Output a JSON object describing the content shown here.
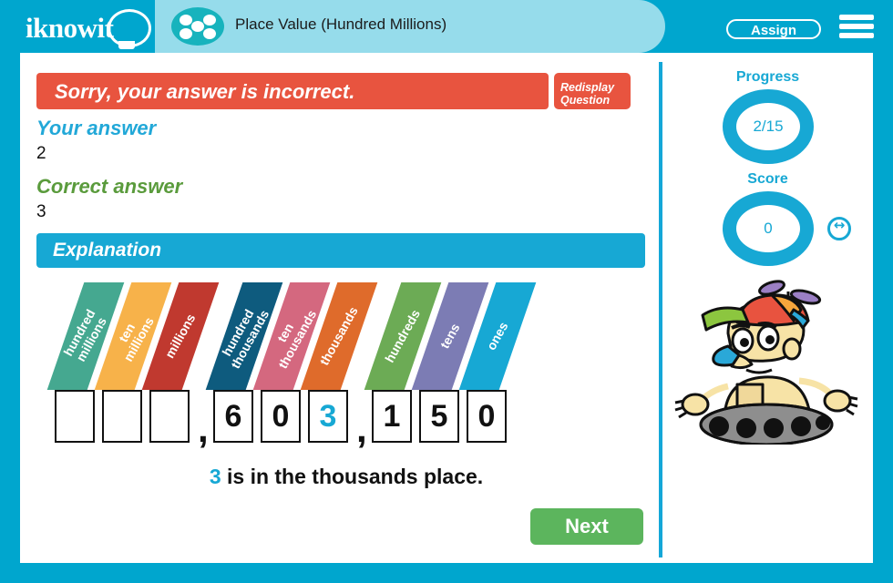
{
  "brand": {
    "logo_text": "iknowit",
    "logo_icon": "lightbulb-icon"
  },
  "header": {
    "topic_title": "Place Value (Hundred Millions)",
    "topic_icon": "five-dots-icon",
    "assign_label": "Assign",
    "menu_icon": "hamburger-menu-icon",
    "bar_color": "#00a6ce",
    "pill_color": "#96dceb"
  },
  "feedback": {
    "result_message": "Sorry, your answer is incorrect.",
    "result_color": "#e8543f",
    "redisplay_line1": "Redisplay",
    "redisplay_line2": "Question",
    "your_answer_label": "Your answer",
    "your_answer_value": "2",
    "your_answer_color": "#22a8d8",
    "correct_answer_label": "Correct answer",
    "correct_answer_value": "3",
    "correct_answer_color": "#5a9b3c",
    "explanation_label": "Explanation",
    "explanation_color": "#17a8d4"
  },
  "place_value_chart": {
    "columns": [
      {
        "label": "hundred millions",
        "color": "#45a890",
        "digit": "",
        "highlight": false
      },
      {
        "label": "ten millions",
        "color": "#f7b24a",
        "digit": "",
        "highlight": false
      },
      {
        "label": "millions",
        "color": "#c0392f",
        "digit": "",
        "highlight": false
      },
      {
        "label": "hundred thousands",
        "color": "#0e5b7e",
        "digit": "6",
        "highlight": false
      },
      {
        "label": "ten thousands",
        "color": "#d4687f",
        "digit": "0",
        "highlight": false
      },
      {
        "label": "thousands",
        "color": "#df6b2b",
        "digit": "3",
        "highlight": true
      },
      {
        "label": "hundreds",
        "color": "#6cab55",
        "digit": "1",
        "highlight": false
      },
      {
        "label": "tens",
        "color": "#7c7cb4",
        "digit": "5",
        "highlight": false
      },
      {
        "label": "ones",
        "color": "#17a8d4",
        "digit": "0",
        "highlight": false
      }
    ],
    "comma_positions": [
      3,
      6
    ],
    "comma": ",",
    "sentence_digit": "3",
    "sentence_rest": " is in the thousands place.",
    "highlight_color": "#17a8d4"
  },
  "actions": {
    "next_label": "Next",
    "next_color": "#5cb55d"
  },
  "sidebar": {
    "progress_label": "Progress",
    "progress_value": "2/15",
    "score_label": "Score",
    "score_value": "0",
    "ring_color": "#17a8d4",
    "mascot_name": "robot-mascot-icon",
    "resize_icon": "resize-horizontal-icon"
  }
}
